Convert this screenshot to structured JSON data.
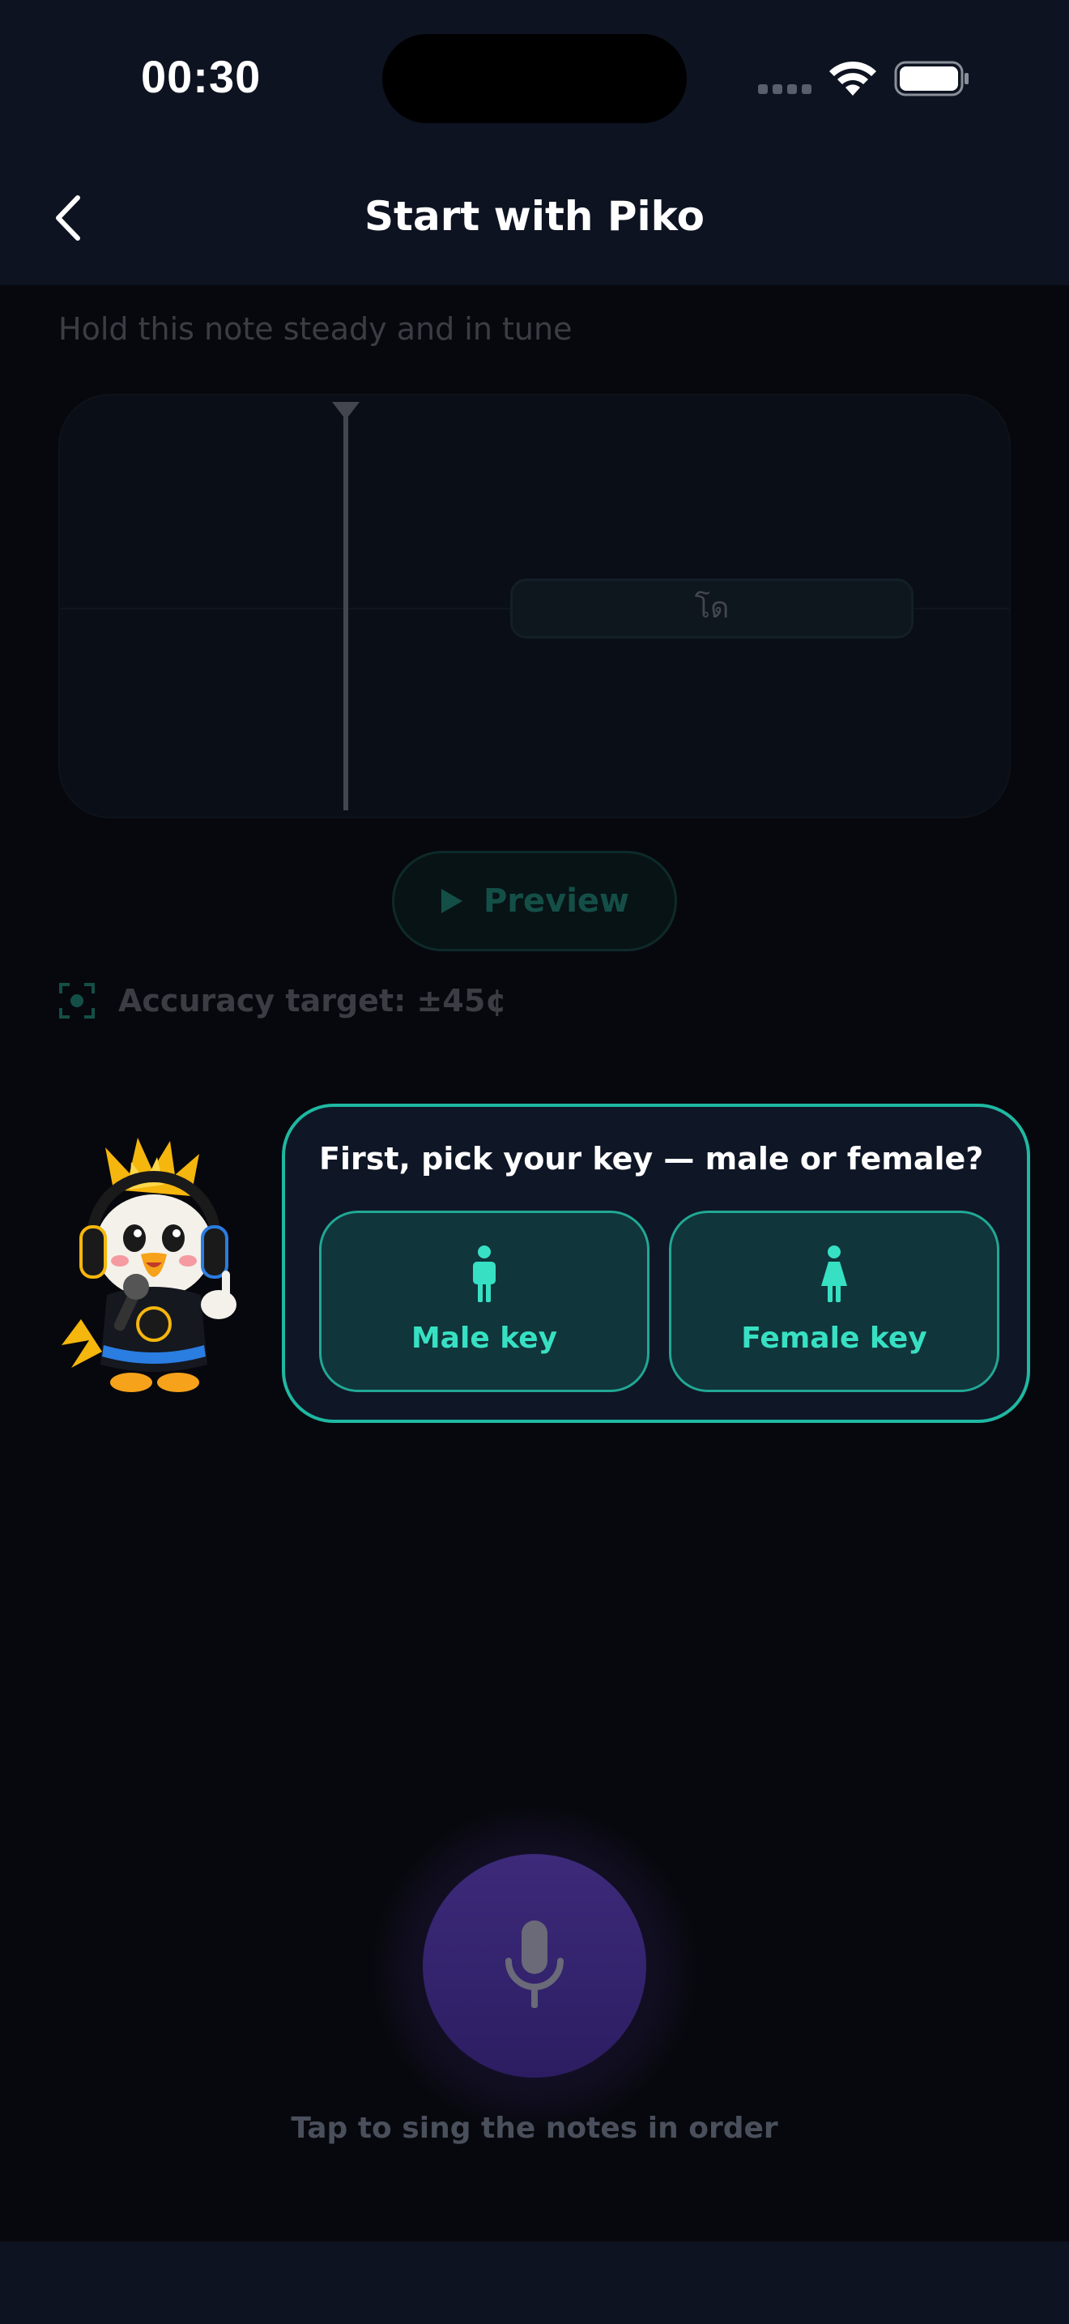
{
  "status_bar": {
    "time": "00:30"
  },
  "header": {
    "title": "Start with Piko",
    "back_icon": "chevron-left-icon"
  },
  "exercise": {
    "instruction": "Hold this note steady and in tune",
    "note_label": "โด",
    "preview_label": "Preview",
    "accuracy_text": "Accuracy target: ±45¢"
  },
  "prompt": {
    "question": "First, pick your key — male or female?",
    "options": [
      {
        "label": "Male key",
        "icon": "male-figure-icon"
      },
      {
        "label": "Female key",
        "icon": "female-figure-icon"
      }
    ]
  },
  "mic": {
    "caption": "Tap to sing the notes in order",
    "icon": "microphone-icon"
  },
  "colors": {
    "accent": "#2fd3b6",
    "bubble_border": "#1fb8a2",
    "mic": "#3d2a7a",
    "background": "#07080d",
    "header": "#0e1321"
  }
}
